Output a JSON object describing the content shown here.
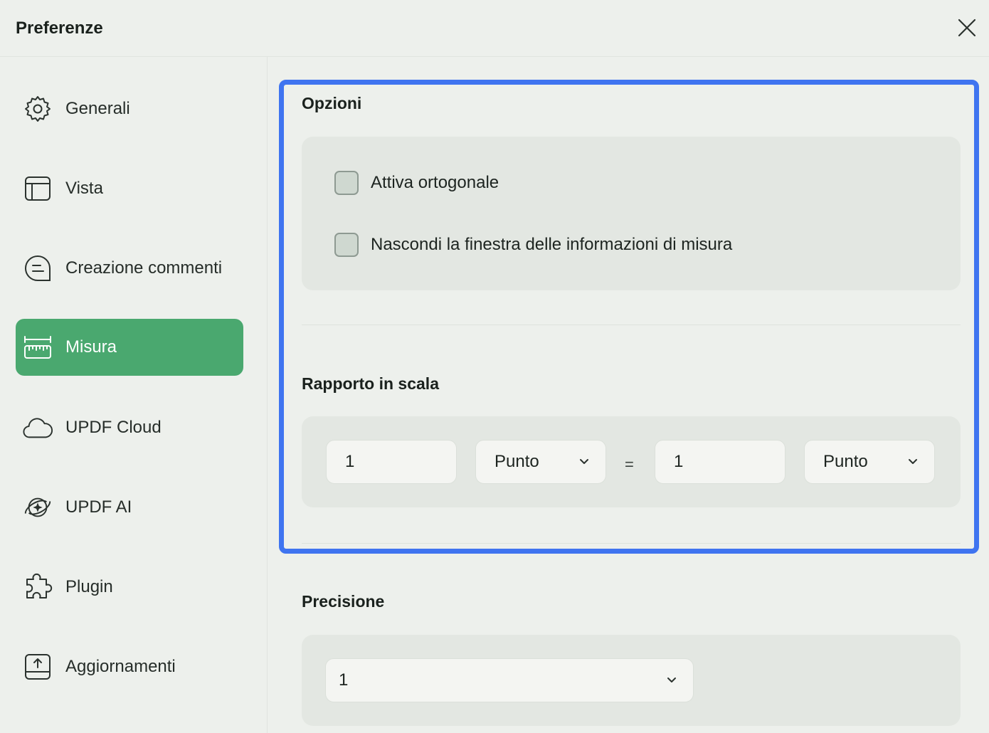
{
  "window": {
    "title": "Preferenze",
    "close_icon": "close-icon"
  },
  "sidebar": {
    "items": [
      {
        "label": "Generali",
        "icon": "gear-icon"
      },
      {
        "label": "Vista",
        "icon": "layout-icon"
      },
      {
        "label": "Creazione commenti",
        "icon": "comment-icon"
      },
      {
        "label": "Misura",
        "icon": "ruler-icon",
        "active": true
      },
      {
        "label": "UPDF Cloud",
        "icon": "cloud-icon"
      },
      {
        "label": "UPDF AI",
        "icon": "ai-sparkle-icon"
      },
      {
        "label": "Plugin",
        "icon": "puzzle-icon"
      },
      {
        "label": "Aggiornamenti",
        "icon": "upload-icon"
      }
    ]
  },
  "options": {
    "title": "Opzioni",
    "checkboxes": [
      {
        "label": "Attiva ortogonale",
        "checked": false
      },
      {
        "label": "Nascondi la finestra delle informazioni di misura",
        "checked": false
      }
    ]
  },
  "scale": {
    "title": "Rapporto in scala",
    "left_value": "1",
    "left_unit": "Punto",
    "equals": "=",
    "right_value": "1",
    "right_unit": "Punto"
  },
  "precision": {
    "title": "Precisione",
    "value": "1"
  },
  "colors": {
    "accent": "#4aa86f",
    "highlight": "#3f74f0",
    "background": "#edf0ec",
    "panel": "#e3e7e2"
  }
}
